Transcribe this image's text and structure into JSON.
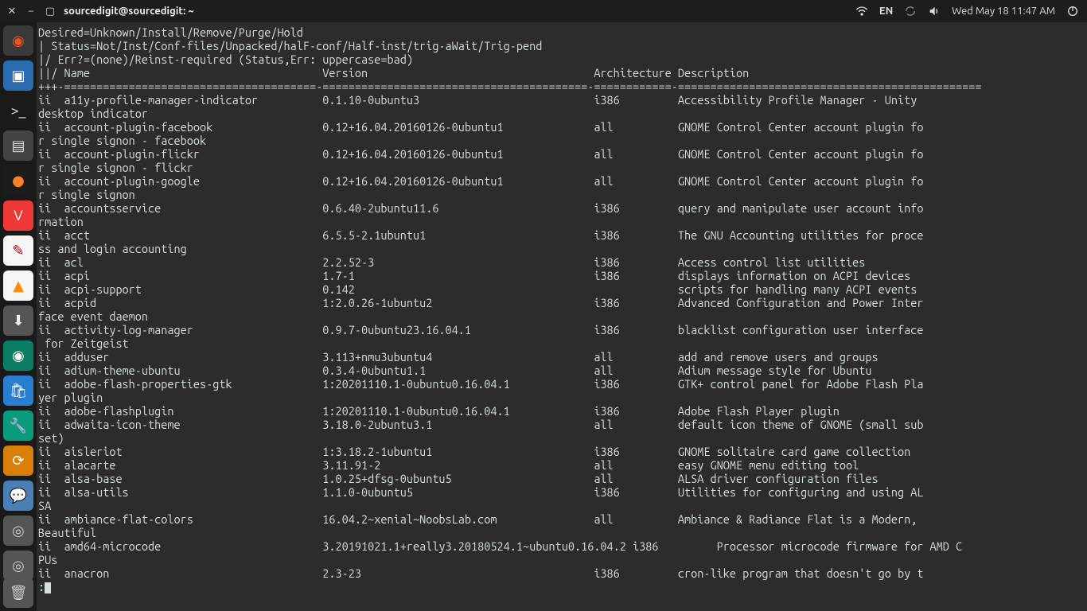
{
  "panel": {
    "title": "sourcedigit@sourcedigit: ~",
    "lang": "EN",
    "datetime": "Wed May 18 11:47 AM"
  },
  "terminal": {
    "header_lines": [
      "Desired=Unknown/Install/Remove/Purge/Hold",
      "| Status=Not/Inst/Conf-files/Unpacked/halF-conf/Half-inst/trig-aWait/Trig-pend",
      "|/ Err?=(none)/Reinst-required (Status,Err: uppercase=bad)"
    ],
    "columns_line": "||/ Name                                    Version                                   Architecture Description",
    "separator": "+++-=======================================-=========================================-============-===============================================",
    "body_lines": [
      "ii  a11y-profile-manager-indicator          0.1.10-0ubuntu3                           i386         Accessibility Profile Manager - Unity",
      "desktop indicator",
      "ii  account-plugin-facebook                 0.12+16.04.20160126-0ubuntu1              all          GNOME Control Center account plugin fo",
      "r single signon - facebook",
      "ii  account-plugin-flickr                   0.12+16.04.20160126-0ubuntu1              all          GNOME Control Center account plugin fo",
      "r single signon - flickr",
      "ii  account-plugin-google                   0.12+16.04.20160126-0ubuntu1              all          GNOME Control Center account plugin fo",
      "r single signon",
      "ii  accountsservice                         0.6.40-2ubuntu11.6                        i386         query and manipulate user account info",
      "rmation",
      "ii  acct                                    6.5.5-2.1ubuntu1                          i386         The GNU Accounting utilities for proce",
      "ss and login accounting",
      "ii  acl                                     2.2.52-3                                  i386         Access control list utilities",
      "ii  acpi                                    1.7-1                                     i386         displays information on ACPI devices",
      "ii  acpi-support                            0.142                                                  scripts for handling many ACPI events",
      "ii  acpid                                   1:2.0.26-1ubuntu2                         i386         Advanced Configuration and Power Inter",
      "face event daemon",
      "ii  activity-log-manager                    0.9.7-0ubuntu23.16.04.1                   i386         blacklist configuration user interface",
      " for Zeitgeist",
      "ii  adduser                                 3.113+nmu3ubuntu4                         all          add and remove users and groups",
      "ii  adium-theme-ubuntu                      0.3.4-0ubuntu1.1                          all          Adium message style for Ubuntu",
      "ii  adobe-flash-properties-gtk              1:20201110.1-0ubuntu0.16.04.1             i386         GTK+ control panel for Adobe Flash Pla",
      "yer plugin",
      "ii  adobe-flashplugin                       1:20201110.1-0ubuntu0.16.04.1             i386         Adobe Flash Player plugin",
      "ii  adwaita-icon-theme                      3.18.0-2ubuntu3.1                         all          default icon theme of GNOME (small sub",
      "set)",
      "ii  aisleriot                               1:3.18.2-1ubuntu1                         i386         GNOME solitaire card game collection",
      "ii  alacarte                                3.11.91-2                                 all          easy GNOME menu editing tool",
      "ii  alsa-base                               1.0.25+dfsg-0ubuntu5                      all          ALSA driver configuration files",
      "ii  alsa-utils                              1.1.0-0ubuntu5                            i386         Utilities for configuring and using AL",
      "SA",
      "ii  ambiance-flat-colors                    16.04.2~xenial~NoobsLab.com               all          Ambiance & Radiance Flat is a Modern,",
      "Beautiful",
      "ii  amd64-microcode                         3.20191021.1+really3.20180524.1~ubuntu0.16.04.2 i386         Processor microcode firmware for AMD C",
      "PUs",
      "ii  anacron                                 2.3-23                                    i386         cron-like program that doesn't go by t"
    ],
    "prompt": ":"
  },
  "launcher_apps": [
    {
      "name": "ubuntu",
      "bg": "#3a3a3a",
      "fg": "#e95420",
      "glyph": "◉"
    },
    {
      "name": "files",
      "bg": "#2b6cb0",
      "fg": "#fff",
      "glyph": "▣"
    },
    {
      "name": "terminal",
      "bg": "#1a1a1a",
      "fg": "#ddd",
      "glyph": ">_"
    },
    {
      "name": "archive",
      "bg": "#444",
      "fg": "#ddd",
      "glyph": "▤"
    },
    {
      "name": "firefox",
      "bg": "#1c1c1c",
      "fg": "#ff7f2a",
      "glyph": "●"
    },
    {
      "name": "vivaldi",
      "bg": "#ef3939",
      "fg": "#fff",
      "glyph": "V"
    },
    {
      "name": "notes",
      "bg": "#f5f5f5",
      "fg": "#b00",
      "glyph": "✎"
    },
    {
      "name": "vlc",
      "bg": "#f5f5f5",
      "fg": "#ff8c00",
      "glyph": "▲"
    },
    {
      "name": "downloads",
      "bg": "#555",
      "fg": "#eee",
      "glyph": "⬇"
    },
    {
      "name": "screenshot",
      "bg": "#0b7d63",
      "fg": "#fff",
      "glyph": "◉"
    },
    {
      "name": "software",
      "bg": "#2a7ecf",
      "fg": "#fff",
      "glyph": "🛍"
    },
    {
      "name": "update",
      "bg": "#0a9b7a",
      "fg": "#fff",
      "glyph": "🔧"
    },
    {
      "name": "sync",
      "bg": "#d87f0a",
      "fg": "#fff",
      "glyph": "⟳"
    },
    {
      "name": "chat",
      "bg": "#4a7fb5",
      "fg": "#fff",
      "glyph": "💬"
    },
    {
      "name": "disk1",
      "bg": "#555",
      "fg": "#ccc",
      "glyph": "◎"
    },
    {
      "name": "disk2",
      "bg": "#555",
      "fg": "#ccc",
      "glyph": "◎"
    }
  ]
}
